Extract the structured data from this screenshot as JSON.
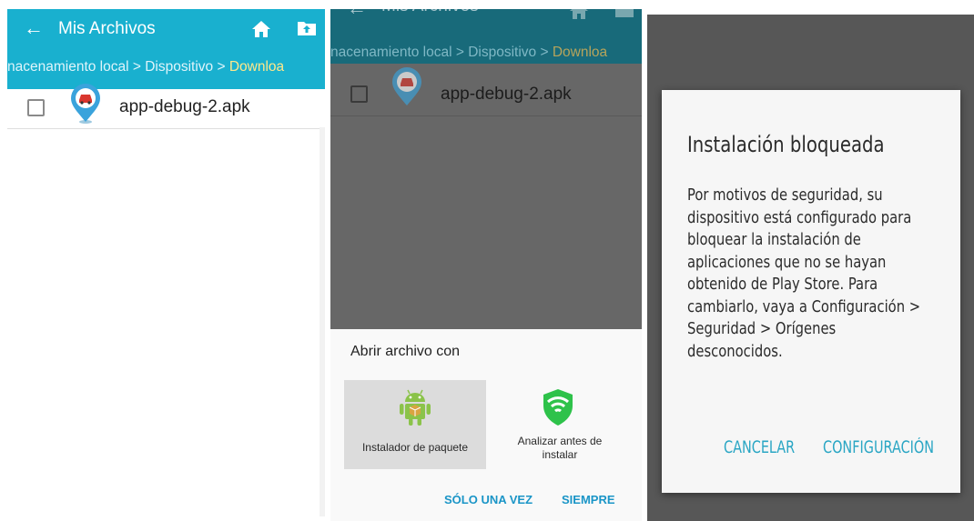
{
  "colors": {
    "appbar": "#19b0cf",
    "accent_button": "#1a95c7",
    "breadcrumb_current": "#ffe88a"
  },
  "app": {
    "title": "Mis Archivos",
    "back_icon": "←",
    "breadcrumb": {
      "path": "nacenamiento local > Dispositivo > ",
      "current": "Downloa"
    }
  },
  "files": [
    {
      "name": "app-debug-2.apk",
      "icon": "map-pin-car-icon"
    }
  ],
  "open_with": {
    "title": "Abrir archivo con",
    "options": [
      {
        "label": "Instalador de paquete",
        "icon": "android-icon",
        "selected": true
      },
      {
        "label": "Analizar antes de instalar",
        "icon": "wifi-shield-icon",
        "selected": false
      }
    ],
    "once_label": "SÓLO UNA VEZ",
    "always_label": "SIEMPRE"
  },
  "dialog": {
    "title": "Instalación bloqueada",
    "message": "Por motivos de seguridad, su\ndispositivo está configurado para\nbloquear la instalación de\naplicaciones que no se hayan\nobtenido de Play Store. Para\ncambiarlo, vaya a Configuración >\nSeguridad > Orígenes\ndesconocidos.",
    "cancel_label": "CANCELAR",
    "settings_label": "CONFIGURACIÓN"
  }
}
